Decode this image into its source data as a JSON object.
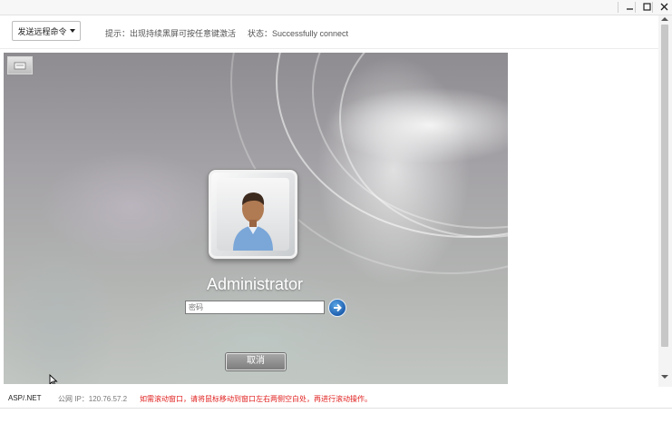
{
  "window": {
    "minimize_icon": "minimize-icon",
    "maximize_icon": "maximize-icon",
    "close_icon": "close-icon"
  },
  "toolbar": {
    "command_button_label": "发送远程命令",
    "hint": "提示：出现持续黑屏可按任意键激活",
    "status": "状态：Successfully connect"
  },
  "remote": {
    "username": "Administrator",
    "password_placeholder": "密码",
    "cancel_label": "取消",
    "submit_icon": "arrow-right-icon",
    "corner_icon": "keyboard-icon"
  },
  "footer": {
    "framework": "ASP/.NET",
    "public_ip": "公网 IP：120.76.57.2",
    "scroll_notice": "如需滚动窗口，请将鼠标移动到窗口左右两侧空白处，再进行滚动操作。"
  },
  "colors": {
    "warning": "#e0211f",
    "submit_blue": "#1f5fae"
  }
}
